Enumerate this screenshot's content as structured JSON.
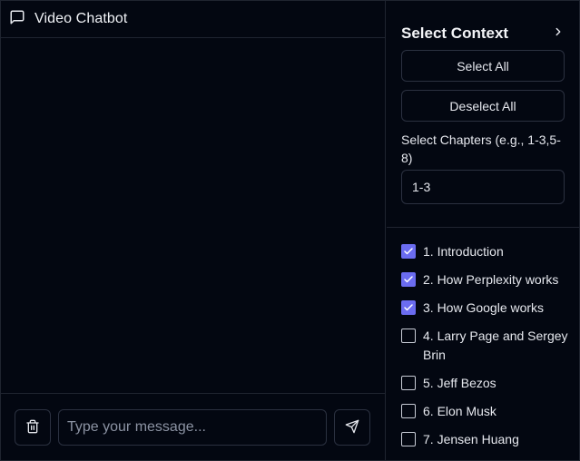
{
  "chat": {
    "title": "Video Chatbot",
    "header_icon": "message-square-icon",
    "input_placeholder": "Type your message...",
    "input_value": "",
    "trash_icon": "trash-icon",
    "send_icon": "send-icon"
  },
  "context": {
    "title": "Select Context",
    "collapse_icon": "chevron-right-icon",
    "select_all_label": "Select All",
    "deselect_all_label": "Deselect All",
    "chapters_label": "Select Chapters (e.g., 1-3,5-8)",
    "chapters_value": "1-3",
    "chapters": [
      {
        "label": "1. Introduction",
        "checked": true
      },
      {
        "label": "2. How Perplexity works",
        "checked": true
      },
      {
        "label": "3. How Google works",
        "checked": true
      },
      {
        "label": "4. Larry Page and Sergey Brin",
        "checked": false
      },
      {
        "label": "5. Jeff Bezos",
        "checked": false
      },
      {
        "label": "6. Elon Musk",
        "checked": false
      },
      {
        "label": "7. Jensen Huang",
        "checked": false
      }
    ]
  },
  "colors": {
    "background": "#030711",
    "border": "#2b3140",
    "accent": "#6b6cf0",
    "text": "#e6e8ee"
  }
}
